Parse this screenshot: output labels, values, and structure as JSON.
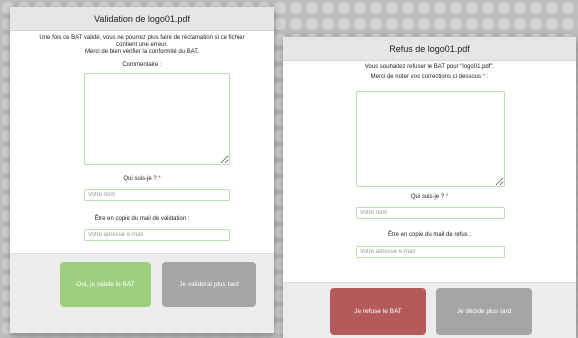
{
  "validation_dialog": {
    "title": "Validation de logo01.pdf",
    "warning_line1": "Une fois ce BAT validé, vous ne pourrez plus faire de réclamation si ce fichier",
    "warning_line2": "contient une erreur.",
    "warning_line3": "Merci de bien vérifier la conformité du BAT.",
    "comment_label": "Commentaire :",
    "comment_value": "",
    "who_label": "Qui suis-je ?",
    "required_mark": "*",
    "name_placeholder": "Votre nom",
    "name_value": "",
    "copy_label": "Être en copie du mail de validation :",
    "email_placeholder": "Votre adresse e-mail",
    "email_value": "",
    "confirm_button": "Oui, je valide le BAT",
    "later_button": "Je validerai plus tard"
  },
  "refusal_dialog": {
    "title": "Refus de logo01.pdf",
    "intro": "Vous souhaitez refuser le BAT pour \"logo01.pdf\".",
    "instruction": "Merci de noter vos corrections ci dessous",
    "required_mark": "*",
    "colon": " :",
    "comment_value": "",
    "who_label": "Qui suis-je ?",
    "name_placeholder": "Votre nom",
    "name_value": "",
    "copy_label": "Être en copie du mail de refus :",
    "email_placeholder": "Votre adresse e-mail",
    "email_value": "",
    "refuse_button": "Je refuse le BAT",
    "later_button": "Je décide plus tard"
  },
  "colors": {
    "confirm_green": "#9ecf7e",
    "refuse_red": "#b55a5a",
    "neutral_gray": "#a5a5a5",
    "field_border": "#b9dcb0",
    "required_red": "#d03030"
  }
}
